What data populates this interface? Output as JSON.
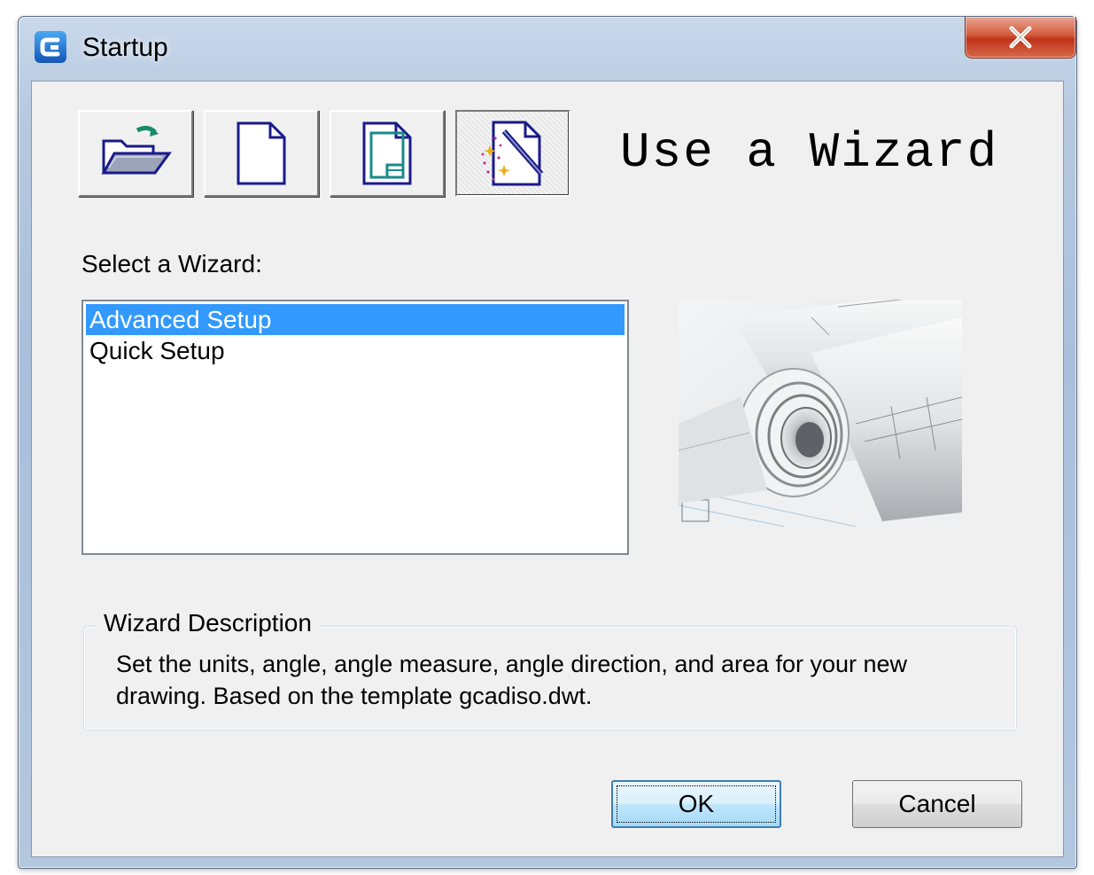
{
  "window": {
    "title": "Startup",
    "close_glyph": "✕"
  },
  "toolbar": {
    "buttons": [
      {
        "icon": "open-folder-icon",
        "pressed": false
      },
      {
        "icon": "blank-page-icon",
        "pressed": false
      },
      {
        "icon": "template-page-icon",
        "pressed": false
      },
      {
        "icon": "wizard-icon",
        "pressed": true
      }
    ]
  },
  "main": {
    "heading": "Use a Wizard",
    "select_label": "Select a Wizard:",
    "wizards": [
      {
        "label": "Advanced Setup",
        "selected": true
      },
      {
        "label": "Quick Setup",
        "selected": false
      }
    ],
    "preview_image": "rolled-blueprints-image"
  },
  "description": {
    "title": "Wizard Description",
    "text": "Set the units, angle, angle measure, angle direction, and area for your new drawing. Based on the template gcadiso.dwt."
  },
  "footer": {
    "ok_label": "OK",
    "cancel_label": "Cancel"
  },
  "colors": {
    "selection": "#3399ff",
    "icon_blue": "#1a1a8c",
    "icon_teal": "#1a8a8a"
  }
}
